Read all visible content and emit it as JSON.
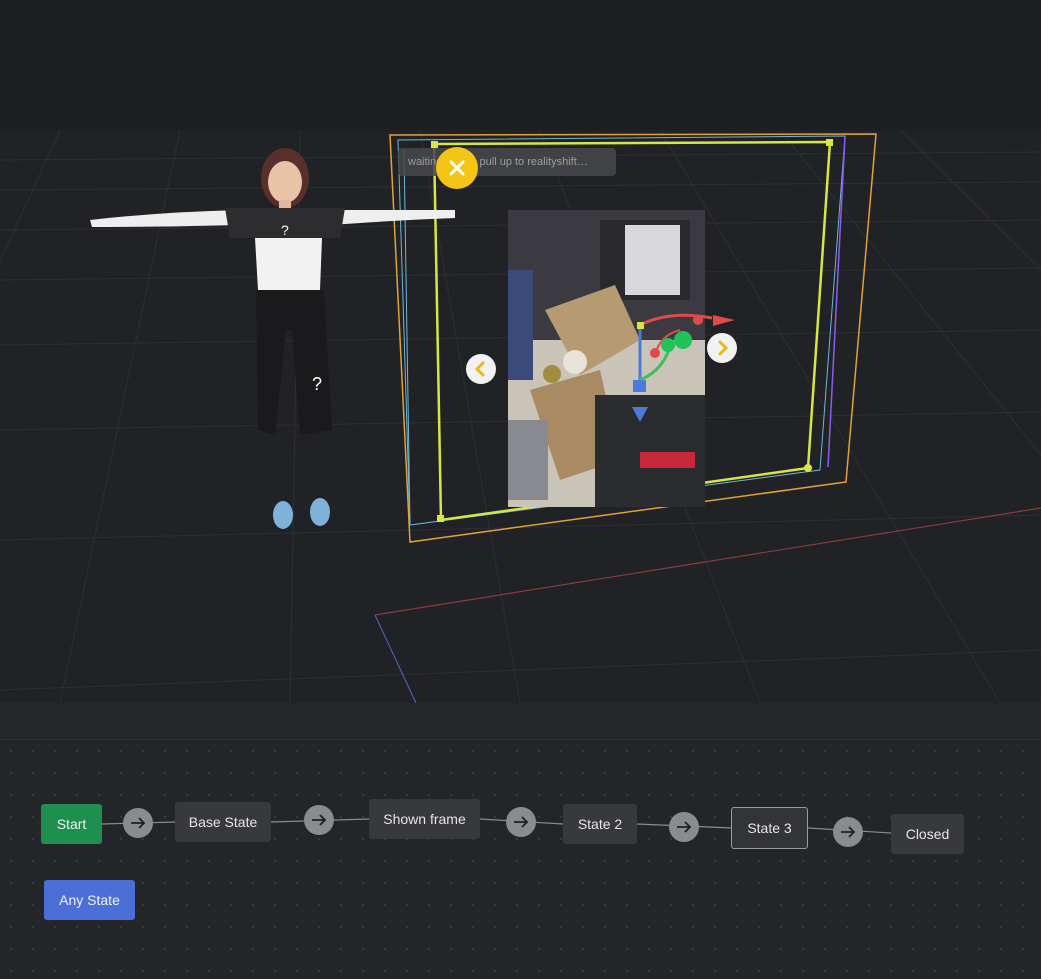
{
  "viewport": {
    "tooltip_text": "waiting … ll to pull up to realityshift…",
    "close_icon": "close-icon",
    "prev_icon": "chevron-left-icon",
    "next_icon": "chevron-right-icon",
    "accent_color": "#f4c514",
    "frame_color": "#d6e642"
  },
  "state_graph": {
    "start_label": "Start",
    "states": [
      "Base State",
      "Shown frame",
      "State 2",
      "State 3",
      "Closed"
    ],
    "any_state_label": "Any State",
    "selected_state": "State 3",
    "colors": {
      "start": "#1f8f4f",
      "any_state": "#4b6fd6",
      "node": "#38393c",
      "connector": "#8a8b8e"
    }
  }
}
